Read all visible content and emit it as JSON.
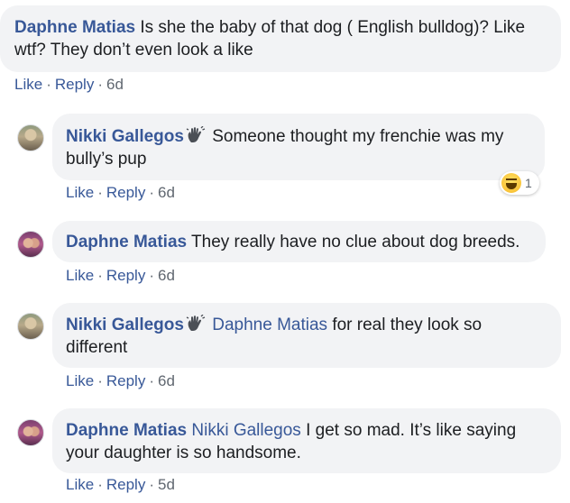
{
  "comments": [
    {
      "author": "Daphne Matias",
      "text": "Is she the baby of that dog ( English bulldog)? Like",
      "text2": "wtf? They don’t even look a like",
      "like": "Like",
      "reply": "Reply",
      "time": "6d"
    },
    {
      "author": "Nikki Gallegos",
      "badge_icon": "waving-hand-icon",
      "text": "Someone thought my frenchie was my",
      "text2": "bully’s pup",
      "like": "Like",
      "reply": "Reply",
      "time": "6d",
      "reaction": {
        "icon": "haha-icon",
        "count": "1"
      }
    },
    {
      "author": "Daphne Matias",
      "text": "They really have no clue about dog breeds.",
      "like": "Like",
      "reply": "Reply",
      "time": "6d"
    },
    {
      "author": "Nikki Gallegos",
      "badge_icon": "waving-hand-icon",
      "mention": "Daphne Matias",
      "text": "for real they look so",
      "text2": "different",
      "like": "Like",
      "reply": "Reply",
      "time": "6d"
    },
    {
      "author": "Daphne Matias",
      "mention": "Nikki Gallegos",
      "text": "I get so mad. It’s like saying",
      "text2": "your daughter is so handsome.",
      "like": "Like",
      "reply": "Reply",
      "time": "5d"
    }
  ],
  "separator": "·",
  "colors": {
    "link": "#385898",
    "bubble": "#f2f3f5",
    "meta": "#606770"
  }
}
